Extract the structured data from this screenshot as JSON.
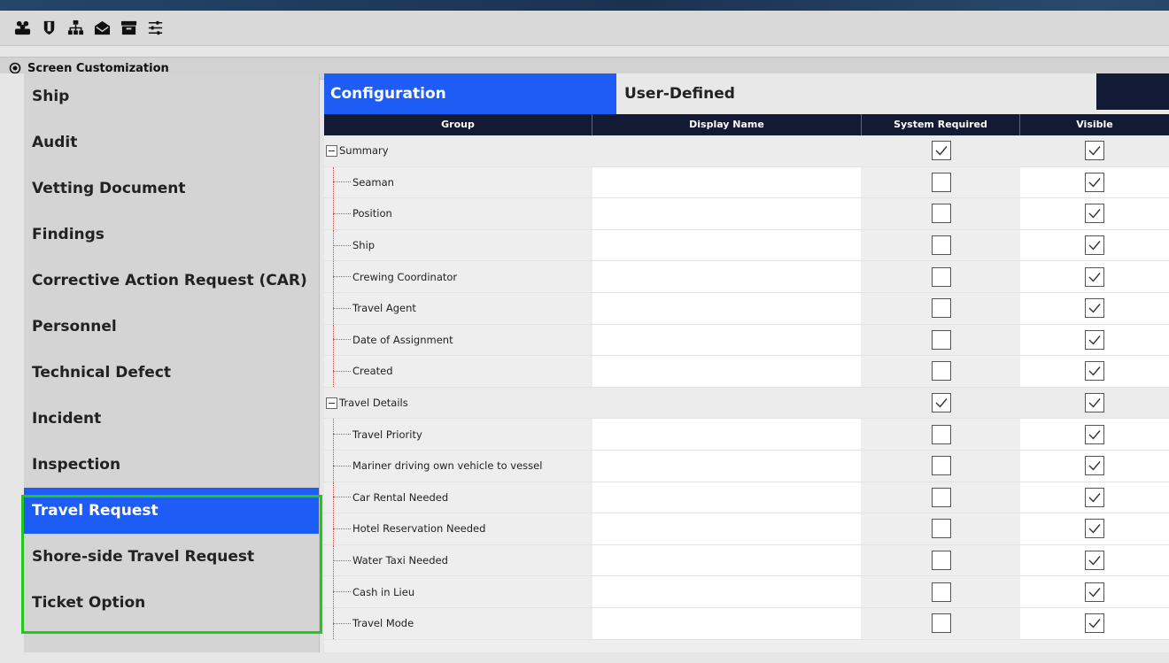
{
  "toolbar": {
    "icons": [
      "users-icon",
      "shield-icon",
      "sitemap-icon",
      "envelope-open-icon",
      "archive-icon",
      "sliders-icon"
    ]
  },
  "section": {
    "title": "Screen Customization"
  },
  "sidebar": {
    "items": [
      {
        "label": "Ship",
        "selected": false
      },
      {
        "label": "Audit",
        "selected": false
      },
      {
        "label": "Vetting Document",
        "selected": false
      },
      {
        "label": "Findings",
        "selected": false
      },
      {
        "label": "Corrective Action Request (CAR)",
        "selected": false
      },
      {
        "label": "Personnel",
        "selected": false
      },
      {
        "label": "Technical Defect",
        "selected": false
      },
      {
        "label": "Incident",
        "selected": false
      },
      {
        "label": "Inspection",
        "selected": false
      },
      {
        "label": "Travel Request",
        "selected": true
      },
      {
        "label": "Shore-side Travel Request",
        "selected": false
      },
      {
        "label": "Ticket Option",
        "selected": false
      }
    ]
  },
  "tabs": [
    {
      "label": "Configuration",
      "active": true
    },
    {
      "label": "User-Defined",
      "active": false
    }
  ],
  "grid": {
    "columns": [
      "Group",
      "Display Name",
      "System Required",
      "Visible"
    ],
    "rows": [
      {
        "type": "group",
        "label": "Summary",
        "display": "",
        "required": true,
        "visible": true
      },
      {
        "type": "item",
        "label": "Seaman",
        "display": "",
        "required": false,
        "visible": true
      },
      {
        "type": "item",
        "label": "Position",
        "display": "",
        "required": false,
        "visible": true
      },
      {
        "type": "item",
        "label": "Ship",
        "display": "",
        "required": false,
        "visible": true
      },
      {
        "type": "item",
        "label": "Crewing Coordinator",
        "display": "",
        "required": false,
        "visible": true
      },
      {
        "type": "item",
        "label": "Travel Agent",
        "display": "",
        "required": false,
        "visible": true
      },
      {
        "type": "item",
        "label": "Date of Assignment",
        "display": "",
        "required": false,
        "visible": true
      },
      {
        "type": "item",
        "label": "Created",
        "display": "",
        "required": false,
        "visible": true
      },
      {
        "type": "group",
        "label": "Travel Details",
        "display": "",
        "required": true,
        "visible": true
      },
      {
        "type": "item",
        "label": "Travel Priority",
        "display": "",
        "required": false,
        "visible": true
      },
      {
        "type": "item",
        "label": "Mariner driving own vehicle to vessel",
        "display": "",
        "required": false,
        "visible": true
      },
      {
        "type": "item",
        "label": "Car Rental Needed",
        "display": "",
        "required": false,
        "visible": true
      },
      {
        "type": "item",
        "label": "Hotel Reservation Needed",
        "display": "",
        "required": false,
        "visible": true
      },
      {
        "type": "item",
        "label": "Water Taxi Needed",
        "display": "",
        "required": false,
        "visible": true
      },
      {
        "type": "item",
        "label": "Cash in Lieu",
        "display": "",
        "required": false,
        "visible": true
      },
      {
        "type": "item",
        "label": "Travel Mode",
        "display": "",
        "required": false,
        "visible": true
      }
    ]
  }
}
